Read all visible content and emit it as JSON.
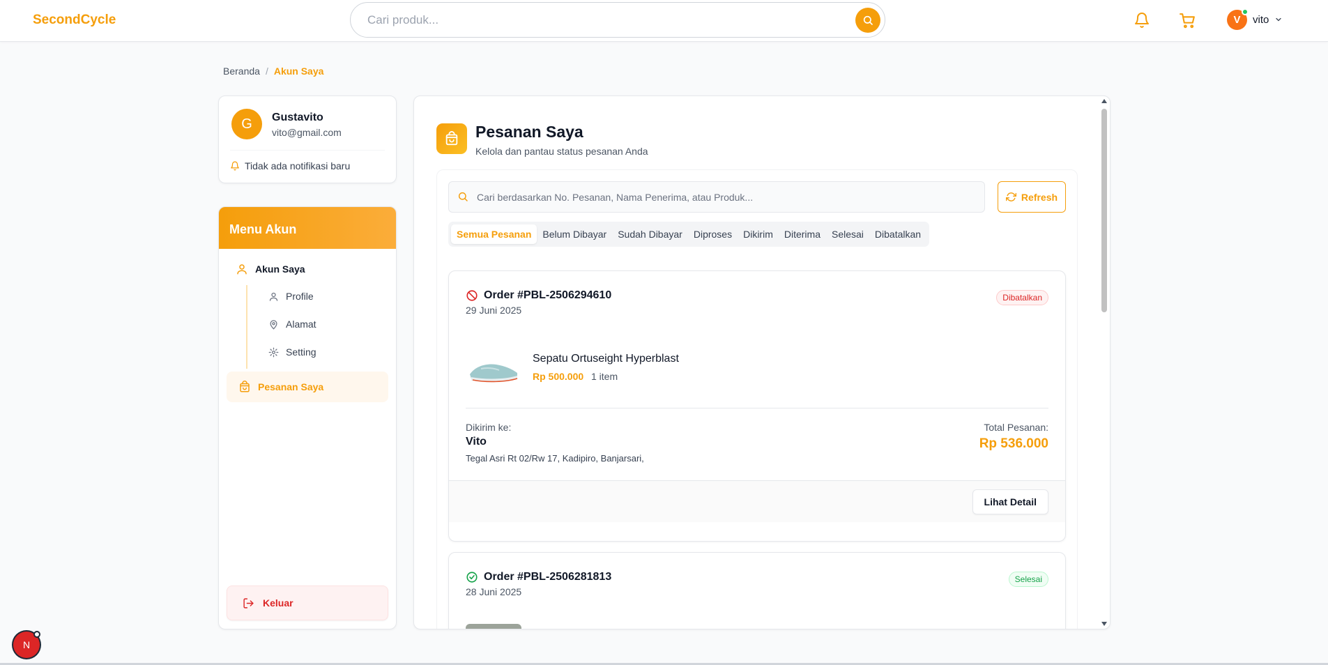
{
  "app": {
    "logo": "SecondCycle"
  },
  "header": {
    "search_placeholder": "Cari produk...",
    "user_initial": "V",
    "user_name": "vito"
  },
  "breadcrumb": {
    "home": "Beranda",
    "separator": "/",
    "current": "Akun Saya"
  },
  "profile": {
    "initial": "G",
    "name": "Gustavito",
    "email": "vito@gmail.com",
    "notification": "Tidak ada notifikasi baru"
  },
  "menu": {
    "title": "Menu Akun",
    "account": "Akun Saya",
    "sub_items": [
      {
        "label": "Profile",
        "icon": "user-icon"
      },
      {
        "label": "Alamat",
        "icon": "map-pin-icon"
      },
      {
        "label": "Setting",
        "icon": "gear-icon"
      }
    ],
    "orders": "Pesanan Saya",
    "logout": "Keluar"
  },
  "main": {
    "title": "Pesanan Saya",
    "subtitle": "Kelola dan pantau status pesanan Anda",
    "search_placeholder": "Cari berdasarkan No. Pesanan, Nama Penerima, atau Produk...",
    "refresh_label": "Refresh",
    "tabs": [
      "Semua Pesanan",
      "Belum Dibayar",
      "Sudah Dibayar",
      "Diproses",
      "Dikirim",
      "Diterima",
      "Selesai",
      "Dibatalkan"
    ],
    "active_tab": "Semua Pesanan"
  },
  "orders": [
    {
      "id": "Order #PBL-2506294610",
      "date": "29 Juni 2025",
      "status": "Dibatalkan",
      "status_icon": "ban-icon",
      "product_name": "Sepatu Ortuseight Hyperblast",
      "product_price": "Rp 500.000",
      "product_qty": "1 item",
      "ship_label": "Dikirim ke:",
      "ship_name": "Vito",
      "ship_address": "Tegal Asri Rt 02/Rw 17, Kadipiro, Banjarsari,",
      "total_label": "Total Pesanan:",
      "total_value": "Rp 536.000",
      "detail_label": "Lihat Detail"
    },
    {
      "id": "Order #PBL-2506281813",
      "date": "28 Juni 2025",
      "status": "Selesai",
      "status_icon": "check-circle-icon"
    }
  ],
  "dev_badge": "N",
  "colors": {
    "accent": "#f59e0b",
    "danger": "#dc2626",
    "success": "#16a34a"
  }
}
